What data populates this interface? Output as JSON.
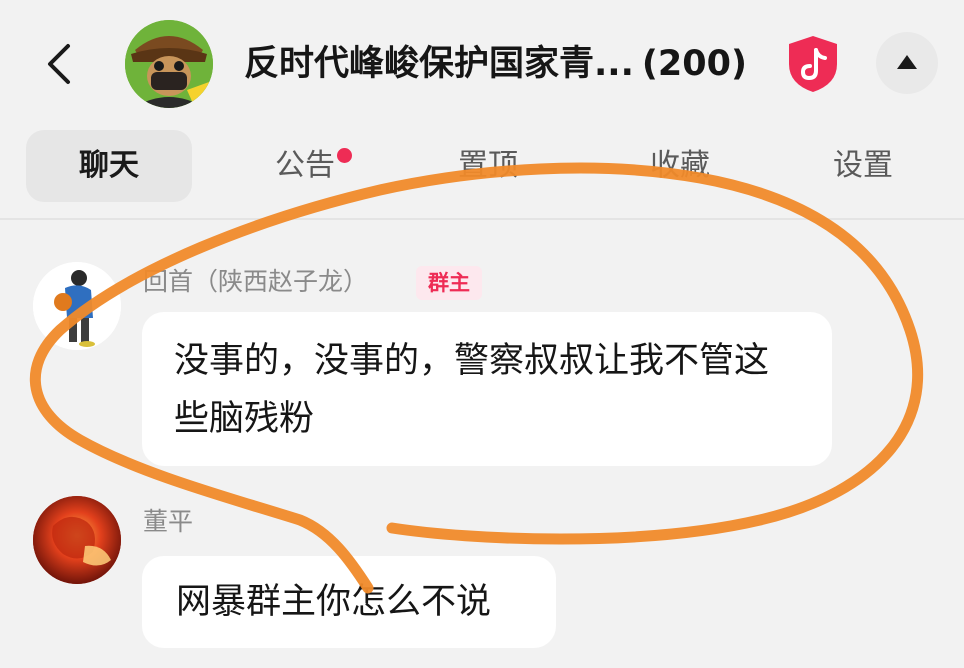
{
  "header": {
    "back_icon": "chevron-left-icon",
    "group_title": "反时代峰峻保护国家青...",
    "member_count": "(200)",
    "badge_icon": "douyin-shield-icon",
    "collapse_icon": "triangle-up-icon"
  },
  "tabs": [
    {
      "label": "聊天",
      "active": true
    },
    {
      "label": "公告",
      "has_dot": true
    },
    {
      "label": "置顶"
    },
    {
      "label": "收藏"
    },
    {
      "label": "设置"
    }
  ],
  "messages": [
    {
      "sender": "回首（陕西赵子龙）",
      "role_badge": "群主",
      "text": "没事的，没事的，警察叔叔让我不管这些脑残粉"
    },
    {
      "sender": "董平",
      "text": "网暴群主你怎么不说"
    }
  ],
  "colors": {
    "accent_red": "#ee2c55",
    "annotation_orange": "#f08a2a",
    "background": "#f2f2f2"
  }
}
